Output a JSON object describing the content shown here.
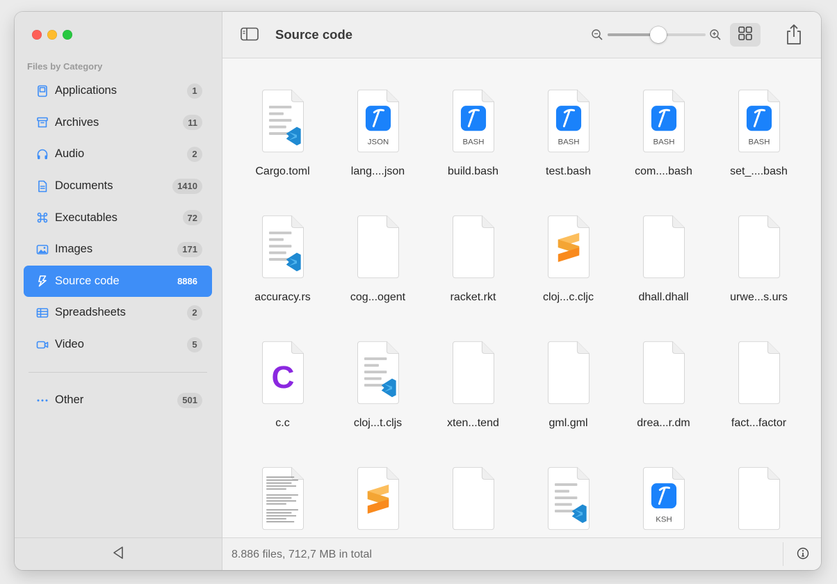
{
  "window": {
    "title": "Source code"
  },
  "colors": {
    "accent": "#3e8ef7",
    "xcode_blue": "#1a82fb",
    "vscode_blue": "#1f8ad2",
    "sublime_orange": "#f98a1d",
    "c_purple": "#8b28e0"
  },
  "sidebar": {
    "header": "Files by Category",
    "items": [
      {
        "label": "Applications",
        "count": "1",
        "icon": "applications-icon"
      },
      {
        "label": "Archives",
        "count": "11",
        "icon": "archive-icon"
      },
      {
        "label": "Audio",
        "count": "2",
        "icon": "headphones-icon"
      },
      {
        "label": "Documents",
        "count": "1410",
        "icon": "document-icon"
      },
      {
        "label": "Executables",
        "count": "72",
        "icon": "command-icon"
      },
      {
        "label": "Images",
        "count": "171",
        "icon": "photo-icon"
      },
      {
        "label": "Source code",
        "count": "8886",
        "icon": "source-code-icon",
        "selected": true
      },
      {
        "label": "Spreadsheets",
        "count": "2",
        "icon": "table-icon"
      },
      {
        "label": "Video",
        "count": "5",
        "icon": "video-icon"
      }
    ],
    "other": {
      "label": "Other",
      "count": "501",
      "icon": "ellipsis-icon"
    }
  },
  "toolbar": {
    "title": "Source code",
    "zoom_level": 0.52
  },
  "files": [
    {
      "name": "Cargo.toml",
      "icon": "vscode-doc"
    },
    {
      "name": "lang....json",
      "icon": "xcode",
      "tag": "JSON"
    },
    {
      "name": "build.bash",
      "icon": "xcode",
      "tag": "BASH"
    },
    {
      "name": "test.bash",
      "icon": "xcode",
      "tag": "BASH"
    },
    {
      "name": "com....bash",
      "icon": "xcode",
      "tag": "BASH"
    },
    {
      "name": "set_....bash",
      "icon": "xcode",
      "tag": "BASH"
    },
    {
      "name": "accuracy.rs",
      "icon": "vscode-doc"
    },
    {
      "name": "cog...ogent",
      "icon": "blank"
    },
    {
      "name": "racket.rkt",
      "icon": "blank"
    },
    {
      "name": "cloj...c.cljc",
      "icon": "sublime"
    },
    {
      "name": "dhall.dhall",
      "icon": "blank"
    },
    {
      "name": "urwe...s.urs",
      "icon": "blank"
    },
    {
      "name": "c.c",
      "icon": "c-lang"
    },
    {
      "name": "cloj...t.cljs",
      "icon": "vscode-doc"
    },
    {
      "name": "xten...tend",
      "icon": "blank"
    },
    {
      "name": "gml.gml",
      "icon": "blank"
    },
    {
      "name": "drea...r.dm",
      "icon": "blank"
    },
    {
      "name": "fact...factor",
      "icon": "blank"
    },
    {
      "name": "",
      "icon": "text-doc"
    },
    {
      "name": "",
      "icon": "sublime"
    },
    {
      "name": "",
      "icon": "blank"
    },
    {
      "name": "",
      "icon": "vscode-doc"
    },
    {
      "name": "",
      "icon": "xcode",
      "tag": "KSH"
    },
    {
      "name": "",
      "icon": "blank"
    }
  ],
  "status": {
    "text": "8.886 files, 712,7 MB in total"
  }
}
